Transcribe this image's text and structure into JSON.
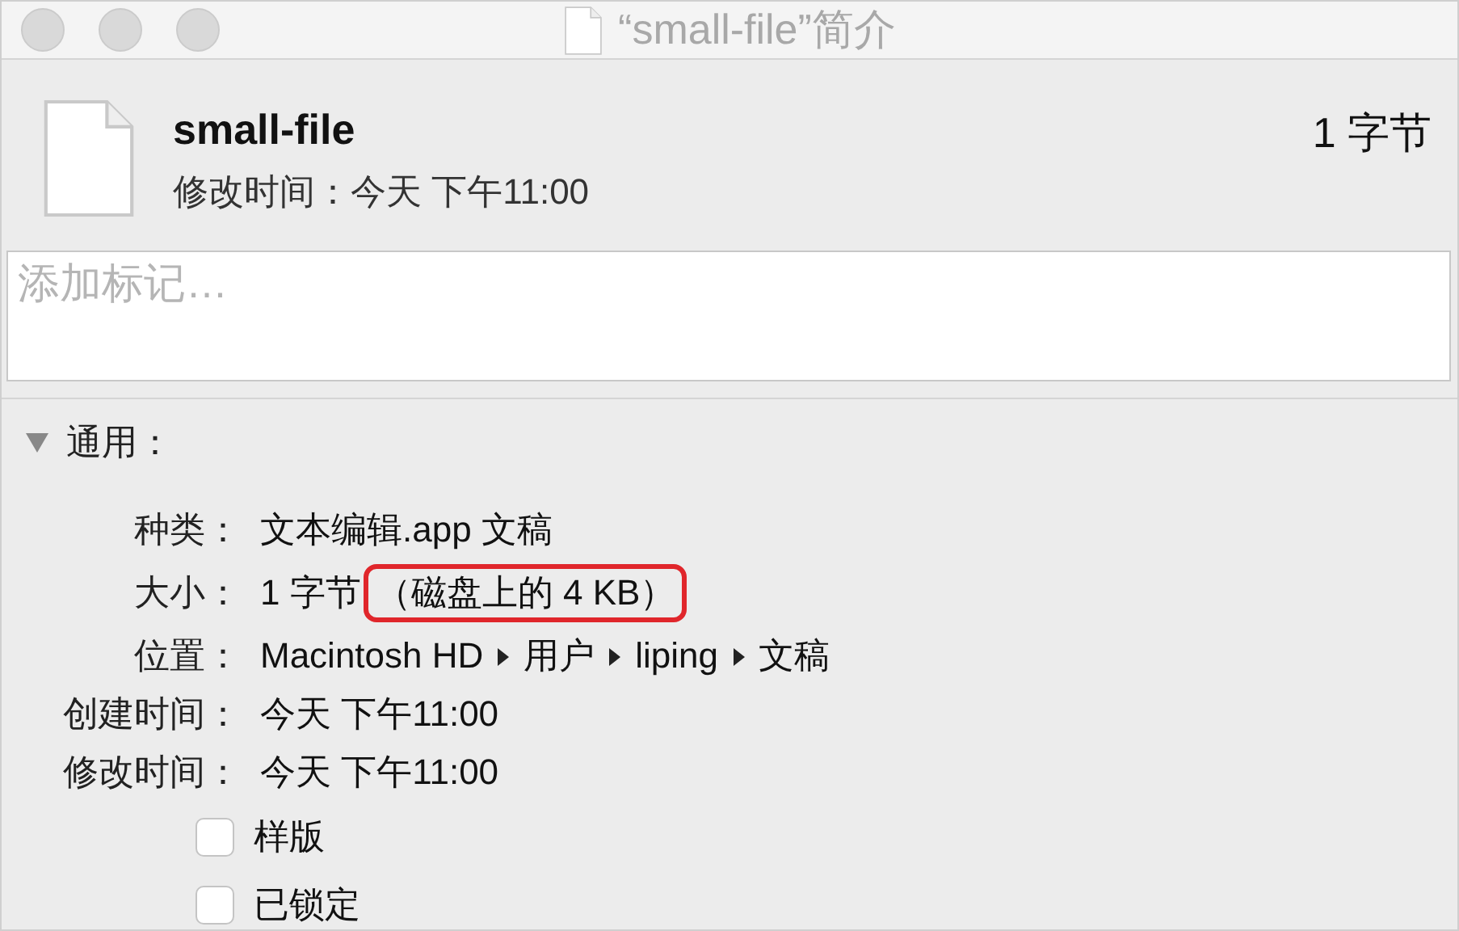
{
  "window": {
    "title": "“small-file”简介"
  },
  "header": {
    "name": "small-file",
    "modified": "修改时间：今天 下午11:00",
    "size": "1 字节"
  },
  "tags": {
    "placeholder": "添加标记…"
  },
  "general": {
    "title": "通用：",
    "expanded": true,
    "rows": [
      {
        "kind": "text",
        "label": "种类：",
        "value": "文本编辑.app 文稿"
      },
      {
        "kind": "size",
        "label": "大小：",
        "value": "1 字节",
        "highlight": "（磁盘上的 4 KB）"
      },
      {
        "kind": "path",
        "label": "位置：",
        "segments": [
          "Macintosh HD",
          "用户",
          "liping",
          "文稿"
        ]
      },
      {
        "kind": "text",
        "label": "创建时间：",
        "value": "今天 下午11:00"
      },
      {
        "kind": "text",
        "label": "修改时间：",
        "value": "今天 下午11:00"
      }
    ],
    "checkboxes": [
      {
        "label": "样版",
        "checked": false
      },
      {
        "label": "已锁定",
        "checked": false
      }
    ]
  }
}
